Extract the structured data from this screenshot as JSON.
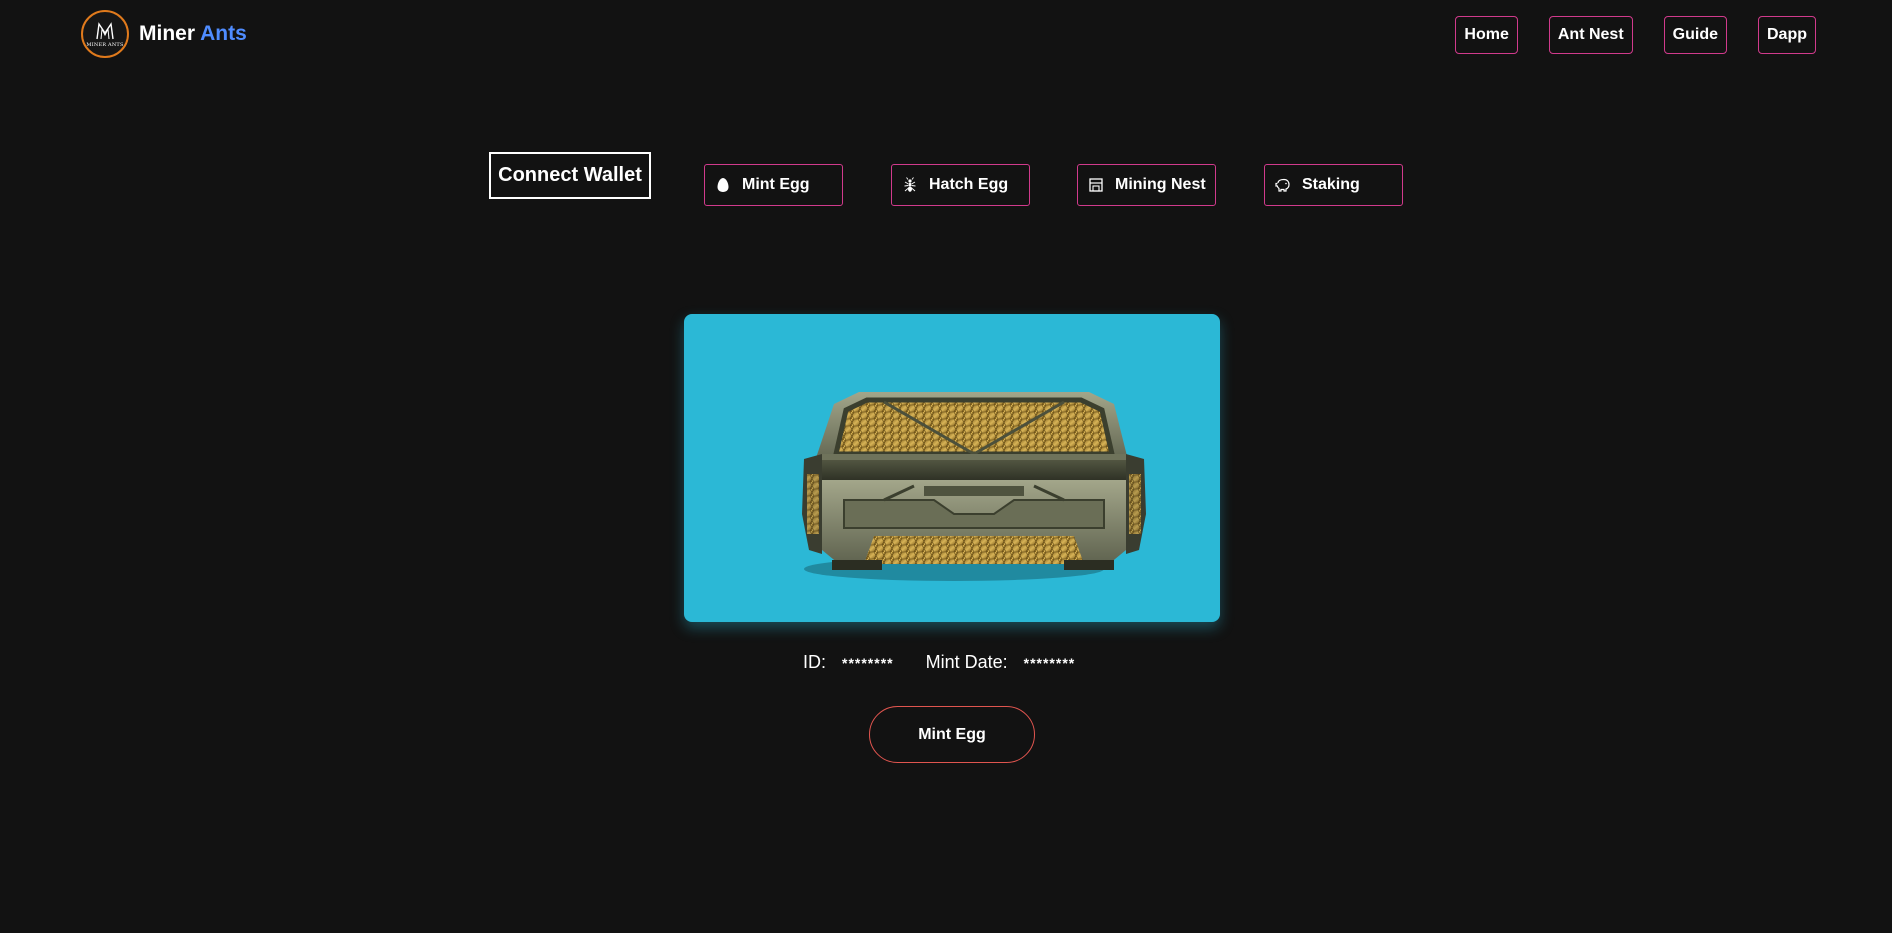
{
  "brand": {
    "name_first": "Miner",
    "name_second": "Ants",
    "logo_caption": "MINER ANTS",
    "accent_color": "#4f8cff"
  },
  "nav": {
    "items": [
      {
        "label": "Home"
      },
      {
        "label": "Ant Nest"
      },
      {
        "label": "Guide"
      },
      {
        "label": "Dapp"
      }
    ],
    "border_color": "#d13a8c"
  },
  "actions": {
    "connect_wallet": "Connect Wallet",
    "buttons": [
      {
        "label": "Mint Egg",
        "icon": "egg-icon"
      },
      {
        "label": "Hatch Egg",
        "icon": "ant-icon"
      },
      {
        "label": "Mining Nest",
        "icon": "nest-icon"
      },
      {
        "label": "Staking",
        "icon": "piggy-bank-icon"
      }
    ]
  },
  "card": {
    "background_color": "#2bb8d6",
    "image": "egg-crate-image"
  },
  "info": {
    "id_label": "ID:",
    "id_value": "********",
    "mint_date_label": "Mint Date:",
    "mint_date_value": "********"
  },
  "mint_button": {
    "label": "Mint Egg",
    "border_color": "#e0554f"
  }
}
